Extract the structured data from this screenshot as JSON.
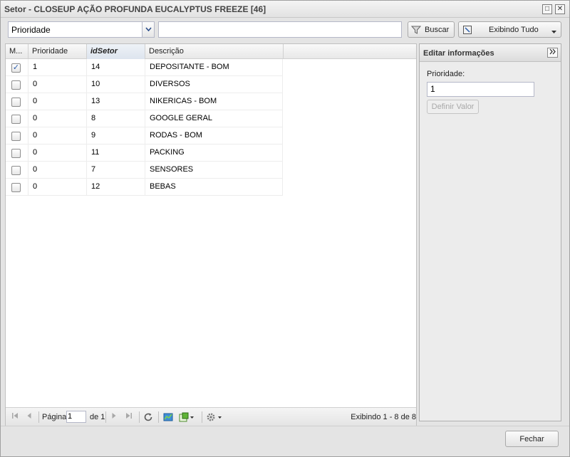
{
  "window": {
    "title": "Setor - CLOSEUP AÇÃO PROFUNDA EUCALYPTUS FREEZE [46]",
    "maximize_glyph": "□",
    "close_glyph": "✕"
  },
  "toolbar": {
    "field_select_value": "Prioridade",
    "search_value": "",
    "search_button_label": "Buscar",
    "display_button_label": "Exibindo Tudo"
  },
  "grid": {
    "columns": [
      "M...",
      "Prioridade",
      "idSetor",
      "Descrição"
    ],
    "rows": [
      {
        "checked": "✓",
        "prioridade": "1",
        "idSetor": "14",
        "descricao": "DEPOSITANTE - BOM"
      },
      {
        "checked": "",
        "prioridade": "0",
        "idSetor": "10",
        "descricao": "DIVERSOS"
      },
      {
        "checked": "",
        "prioridade": "0",
        "idSetor": "13",
        "descricao": "NIKERICAS - BOM"
      },
      {
        "checked": "",
        "prioridade": "0",
        "idSetor": "8",
        "descricao": "GOOGLE GERAL"
      },
      {
        "checked": "",
        "prioridade": "0",
        "idSetor": "9",
        "descricao": "RODAS - BOM"
      },
      {
        "checked": "",
        "prioridade": "0",
        "idSetor": "11",
        "descricao": "PACKING"
      },
      {
        "checked": "",
        "prioridade": "0",
        "idSetor": "7",
        "descricao": "SENSORES"
      },
      {
        "checked": "",
        "prioridade": "0",
        "idSetor": "12",
        "descricao": "BEBAS"
      }
    ]
  },
  "paging": {
    "page_label": "Página",
    "page_value": "1",
    "of_label": "de 1",
    "info": "Exibindo 1 - 8 de 8"
  },
  "edit_panel": {
    "title": "Editar informações",
    "field_label": "Prioridade:",
    "field_value": "1",
    "set_value_button": "Definir Valor"
  },
  "footer": {
    "close_button_label": "Fechar"
  }
}
